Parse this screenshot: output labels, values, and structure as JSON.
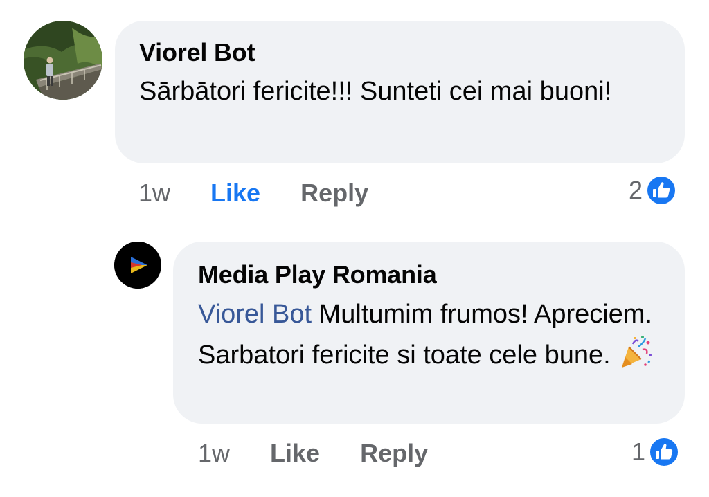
{
  "comment": {
    "author": "Viorel Bot",
    "text": "Sārbātori fericite!!! Sunteti cei mai buoni!",
    "time": "1w",
    "like_label": "Like",
    "reply_label": "Reply",
    "reaction_count": "2",
    "like_active": true
  },
  "reply": {
    "author": "Media Play Romania",
    "mention": "Viorel Bot",
    "text": " Multumim frumos! Apreciem. Sarbatori fericite si toate cele bune.",
    "emoji": "party-popper-icon",
    "time": "1w",
    "like_label": "Like",
    "reply_label": "Reply",
    "reaction_count": "1",
    "like_active": false
  },
  "colors": {
    "bubble": "#f0f2f5",
    "link_blue": "#1877f2",
    "mention_blue": "#385898",
    "meta_grey": "#65676b"
  }
}
